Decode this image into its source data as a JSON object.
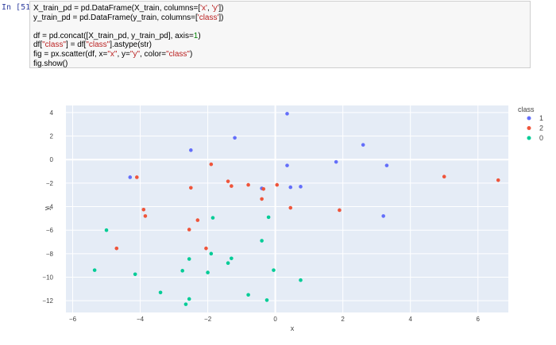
{
  "notebook": {
    "prompt": "In [51]:",
    "code_lines": [
      [
        {
          "t": "X_train_pd = pd.DataFrame(X_train, columns=["
        },
        {
          "t": "'x'",
          "c": "s"
        },
        {
          "t": ", "
        },
        {
          "t": "'y'",
          "c": "s"
        },
        {
          "t": "])"
        }
      ],
      [
        {
          "t": "y_train_pd = pd.DataFrame(y_train, columns=["
        },
        {
          "t": "'class'",
          "c": "s"
        },
        {
          "t": "])"
        }
      ],
      [],
      [
        {
          "t": "df = pd.concat([X_train_pd, y_train_pd], axis="
        },
        {
          "t": "1",
          "c": "n"
        },
        {
          "t": ")"
        }
      ],
      [
        {
          "t": "df["
        },
        {
          "t": "\"class\"",
          "c": "s"
        },
        {
          "t": "] = df["
        },
        {
          "t": "\"class\"",
          "c": "s"
        },
        {
          "t": "].astype(str)"
        }
      ],
      [
        {
          "t": "fig = px.scatter(df, x="
        },
        {
          "t": "\"x\"",
          "c": "s"
        },
        {
          "t": ", y="
        },
        {
          "t": "\"y\"",
          "c": "s"
        },
        {
          "t": ", color="
        },
        {
          "t": "\"class\"",
          "c": "s"
        },
        {
          "t": ")"
        }
      ],
      [
        {
          "t": "fig.show()"
        }
      ]
    ]
  },
  "chart_data": {
    "type": "scatter",
    "xlabel": "x",
    "ylabel": "y",
    "xlim": [
      -6.2,
      6.9
    ],
    "ylim": [
      -13,
      4.6
    ],
    "xticks": [
      -6,
      -4,
      -2,
      0,
      2,
      4,
      6
    ],
    "yticks": [
      -12,
      -10,
      -8,
      -6,
      -4,
      -2,
      0,
      2,
      4
    ],
    "grid": true,
    "legend_title": "class",
    "legend_position": "right",
    "series": [
      {
        "name": "1",
        "color": "#636efa",
        "points": [
          [
            0.35,
            3.9
          ],
          [
            -1.2,
            1.85
          ],
          [
            2.6,
            1.25
          ],
          [
            -2.5,
            0.8
          ],
          [
            1.8,
            -0.2
          ],
          [
            3.3,
            -0.5
          ],
          [
            0.35,
            -0.5
          ],
          [
            -4.3,
            -1.5
          ],
          [
            0.45,
            -2.35
          ],
          [
            0.75,
            -2.3
          ],
          [
            -0.4,
            -2.45
          ],
          [
            3.2,
            -4.8
          ]
        ]
      },
      {
        "name": "2",
        "color": "#ef553b",
        "points": [
          [
            -1.9,
            -0.4
          ],
          [
            -4.1,
            -1.5
          ],
          [
            5.0,
            -1.45
          ],
          [
            6.6,
            -1.75
          ],
          [
            -1.4,
            -1.85
          ],
          [
            -0.8,
            -2.15
          ],
          [
            0.05,
            -2.15
          ],
          [
            -1.3,
            -2.25
          ],
          [
            -2.5,
            -2.4
          ],
          [
            -0.35,
            -2.5
          ],
          [
            -0.4,
            -3.35
          ],
          [
            0.45,
            -4.1
          ],
          [
            -3.9,
            -4.25
          ],
          [
            1.9,
            -4.3
          ],
          [
            -3.85,
            -4.8
          ],
          [
            -2.3,
            -5.15
          ],
          [
            -2.55,
            -5.95
          ],
          [
            -4.7,
            -7.55
          ],
          [
            -2.05,
            -7.55
          ]
        ]
      },
      {
        "name": "0",
        "color": "#00cc96",
        "points": [
          [
            -0.2,
            -4.9
          ],
          [
            -1.85,
            -4.95
          ],
          [
            -5.0,
            -6.0
          ],
          [
            -0.4,
            -6.9
          ],
          [
            -1.9,
            -8.0
          ],
          [
            -1.3,
            -8.4
          ],
          [
            -2.55,
            -8.45
          ],
          [
            -1.4,
            -8.8
          ],
          [
            -5.35,
            -9.4
          ],
          [
            -2.75,
            -9.45
          ],
          [
            -0.05,
            -9.4
          ],
          [
            -2.0,
            -9.6
          ],
          [
            -4.15,
            -9.75
          ],
          [
            0.75,
            -10.25
          ],
          [
            -3.4,
            -11.3
          ],
          [
            -0.8,
            -11.5
          ],
          [
            -2.55,
            -11.85
          ],
          [
            -0.25,
            -11.95
          ],
          [
            -2.65,
            -12.3
          ]
        ]
      }
    ]
  }
}
